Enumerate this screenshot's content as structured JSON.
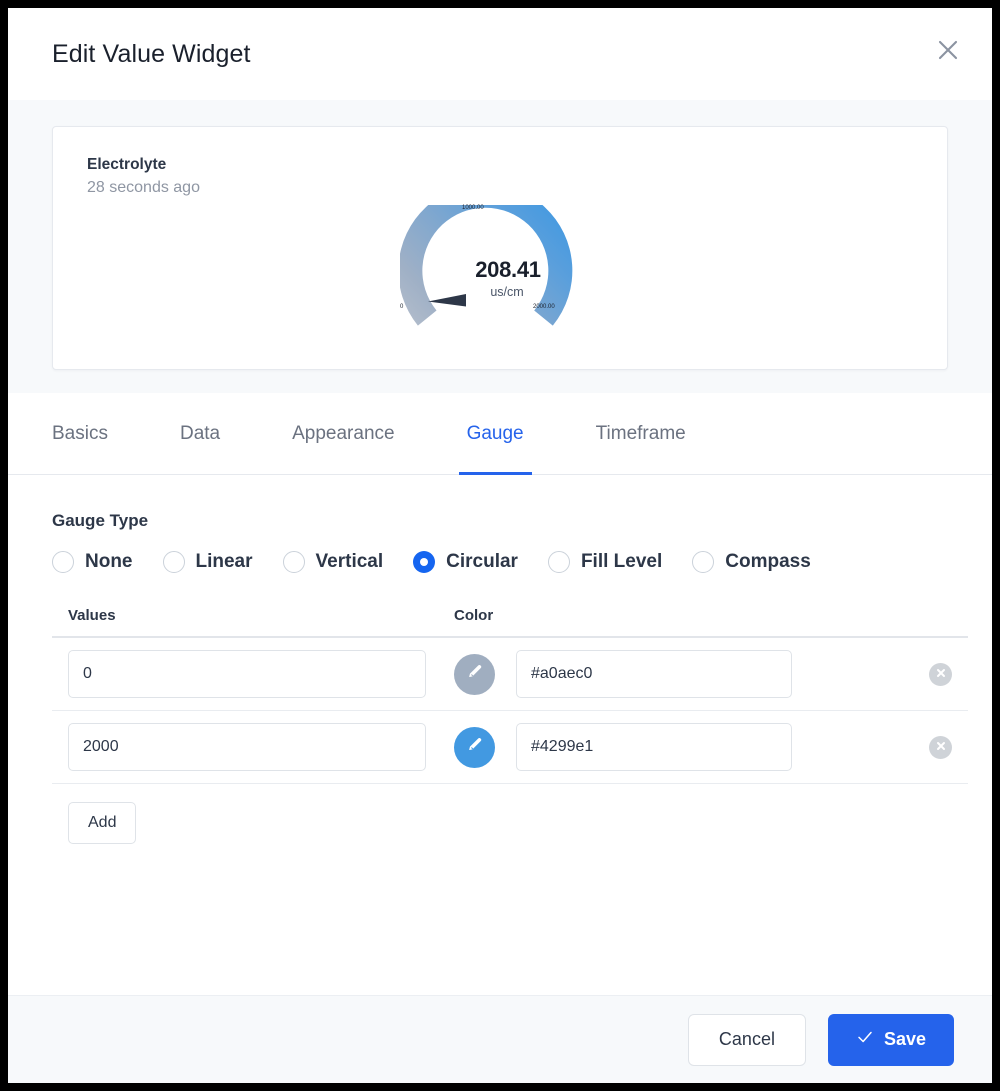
{
  "dialog": {
    "title": "Edit Value Widget",
    "close_icon": "close-icon"
  },
  "preview": {
    "widget_name": "Electrolyte",
    "timestamp": "28 seconds ago",
    "gauge": {
      "value_text": "208.41",
      "value": 208.41,
      "unit": "us/cm",
      "min_label": "0",
      "mid_label": "1000.00",
      "max_label": "2000.00",
      "min": 0,
      "max": 2000,
      "start_color": "#a0aec0",
      "end_color": "#4299e1",
      "needle_color": "#2d3748"
    }
  },
  "tabs": [
    {
      "label": "Basics",
      "active": false
    },
    {
      "label": "Data",
      "active": false
    },
    {
      "label": "Appearance",
      "active": false
    },
    {
      "label": "Gauge",
      "active": true
    },
    {
      "label": "Timeframe",
      "active": false
    }
  ],
  "gauge_type": {
    "section_label": "Gauge Type",
    "options": [
      {
        "label": "None",
        "selected": false
      },
      {
        "label": "Linear",
        "selected": false
      },
      {
        "label": "Vertical",
        "selected": false
      },
      {
        "label": "Circular",
        "selected": true
      },
      {
        "label": "Fill Level",
        "selected": false
      },
      {
        "label": "Compass",
        "selected": false
      }
    ],
    "selected": "Circular"
  },
  "values_table": {
    "headers": {
      "values": "Values",
      "color": "Color"
    },
    "rows": [
      {
        "value": "0",
        "color": "#a0aec0",
        "swatch": "#a0aec0"
      },
      {
        "value": "2000",
        "color": "#4299e1",
        "swatch": "#4299e1"
      }
    ],
    "add_label": "Add"
  },
  "footer": {
    "cancel_label": "Cancel",
    "save_label": "Save"
  },
  "accent_color": "#2563eb"
}
